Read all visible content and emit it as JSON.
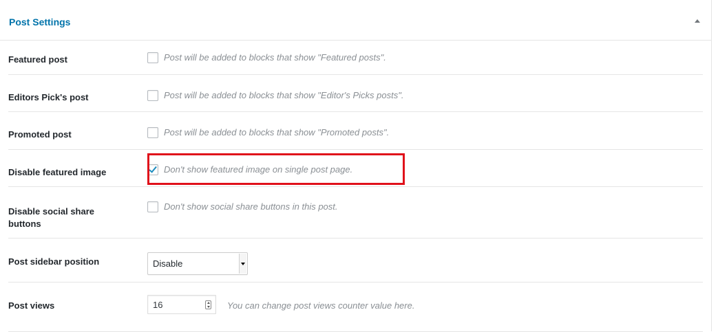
{
  "panel": {
    "title": "Post Settings",
    "collapse_icon": "triangle-up-icon"
  },
  "settings": {
    "featured": {
      "label": "Featured post",
      "checked": false,
      "description": "Post will be added to blocks that show \"Featured posts\"."
    },
    "editors_pick": {
      "label": "Editors Pick's post",
      "checked": false,
      "description": "Post will be added to blocks that show \"Editor's Picks posts\"."
    },
    "promoted": {
      "label": "Promoted post",
      "checked": false,
      "description": "Post will be added to blocks that show \"Promoted posts\"."
    },
    "disable_featured_image": {
      "label": "Disable featured image",
      "checked": true,
      "description": "Don't show featured image on single post page."
    },
    "disable_social_share": {
      "label": "Disable social share buttons",
      "checked": false,
      "description": "Don't show social share buttons in this post."
    },
    "sidebar_position": {
      "label": "Post sidebar position",
      "selected": "Disable"
    },
    "post_views": {
      "label": "Post views",
      "value": "16",
      "description": "You can change post views counter value here."
    }
  },
  "colors": {
    "accent": "#0073aa",
    "highlight": "#e0101a",
    "check": "#1e8cbe"
  }
}
